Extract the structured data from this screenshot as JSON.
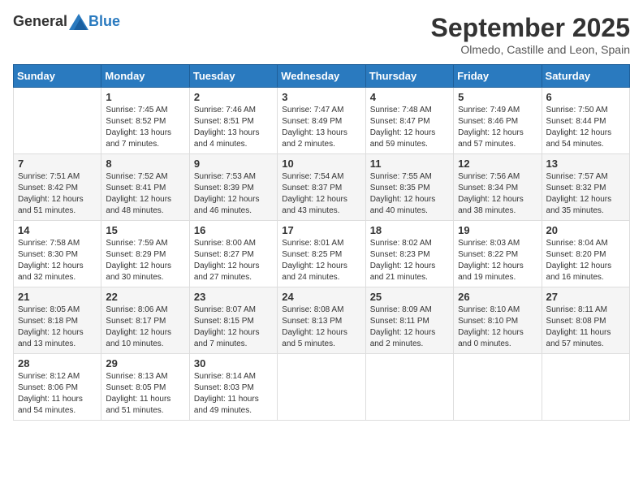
{
  "logo": {
    "general": "General",
    "blue": "Blue"
  },
  "title": "September 2025",
  "subtitle": "Olmedo, Castille and Leon, Spain",
  "days_of_week": [
    "Sunday",
    "Monday",
    "Tuesday",
    "Wednesday",
    "Thursday",
    "Friday",
    "Saturday"
  ],
  "weeks": [
    [
      {
        "day": "",
        "info": ""
      },
      {
        "day": "1",
        "info": "Sunrise: 7:45 AM\nSunset: 8:52 PM\nDaylight: 13 hours\nand 7 minutes."
      },
      {
        "day": "2",
        "info": "Sunrise: 7:46 AM\nSunset: 8:51 PM\nDaylight: 13 hours\nand 4 minutes."
      },
      {
        "day": "3",
        "info": "Sunrise: 7:47 AM\nSunset: 8:49 PM\nDaylight: 13 hours\nand 2 minutes."
      },
      {
        "day": "4",
        "info": "Sunrise: 7:48 AM\nSunset: 8:47 PM\nDaylight: 12 hours\nand 59 minutes."
      },
      {
        "day": "5",
        "info": "Sunrise: 7:49 AM\nSunset: 8:46 PM\nDaylight: 12 hours\nand 57 minutes."
      },
      {
        "day": "6",
        "info": "Sunrise: 7:50 AM\nSunset: 8:44 PM\nDaylight: 12 hours\nand 54 minutes."
      }
    ],
    [
      {
        "day": "7",
        "info": "Sunrise: 7:51 AM\nSunset: 8:42 PM\nDaylight: 12 hours\nand 51 minutes."
      },
      {
        "day": "8",
        "info": "Sunrise: 7:52 AM\nSunset: 8:41 PM\nDaylight: 12 hours\nand 48 minutes."
      },
      {
        "day": "9",
        "info": "Sunrise: 7:53 AM\nSunset: 8:39 PM\nDaylight: 12 hours\nand 46 minutes."
      },
      {
        "day": "10",
        "info": "Sunrise: 7:54 AM\nSunset: 8:37 PM\nDaylight: 12 hours\nand 43 minutes."
      },
      {
        "day": "11",
        "info": "Sunrise: 7:55 AM\nSunset: 8:35 PM\nDaylight: 12 hours\nand 40 minutes."
      },
      {
        "day": "12",
        "info": "Sunrise: 7:56 AM\nSunset: 8:34 PM\nDaylight: 12 hours\nand 38 minutes."
      },
      {
        "day": "13",
        "info": "Sunrise: 7:57 AM\nSunset: 8:32 PM\nDaylight: 12 hours\nand 35 minutes."
      }
    ],
    [
      {
        "day": "14",
        "info": "Sunrise: 7:58 AM\nSunset: 8:30 PM\nDaylight: 12 hours\nand 32 minutes."
      },
      {
        "day": "15",
        "info": "Sunrise: 7:59 AM\nSunset: 8:29 PM\nDaylight: 12 hours\nand 30 minutes."
      },
      {
        "day": "16",
        "info": "Sunrise: 8:00 AM\nSunset: 8:27 PM\nDaylight: 12 hours\nand 27 minutes."
      },
      {
        "day": "17",
        "info": "Sunrise: 8:01 AM\nSunset: 8:25 PM\nDaylight: 12 hours\nand 24 minutes."
      },
      {
        "day": "18",
        "info": "Sunrise: 8:02 AM\nSunset: 8:23 PM\nDaylight: 12 hours\nand 21 minutes."
      },
      {
        "day": "19",
        "info": "Sunrise: 8:03 AM\nSunset: 8:22 PM\nDaylight: 12 hours\nand 19 minutes."
      },
      {
        "day": "20",
        "info": "Sunrise: 8:04 AM\nSunset: 8:20 PM\nDaylight: 12 hours\nand 16 minutes."
      }
    ],
    [
      {
        "day": "21",
        "info": "Sunrise: 8:05 AM\nSunset: 8:18 PM\nDaylight: 12 hours\nand 13 minutes."
      },
      {
        "day": "22",
        "info": "Sunrise: 8:06 AM\nSunset: 8:17 PM\nDaylight: 12 hours\nand 10 minutes."
      },
      {
        "day": "23",
        "info": "Sunrise: 8:07 AM\nSunset: 8:15 PM\nDaylight: 12 hours\nand 7 minutes."
      },
      {
        "day": "24",
        "info": "Sunrise: 8:08 AM\nSunset: 8:13 PM\nDaylight: 12 hours\nand 5 minutes."
      },
      {
        "day": "25",
        "info": "Sunrise: 8:09 AM\nSunset: 8:11 PM\nDaylight: 12 hours\nand 2 minutes."
      },
      {
        "day": "26",
        "info": "Sunrise: 8:10 AM\nSunset: 8:10 PM\nDaylight: 12 hours\nand 0 minutes."
      },
      {
        "day": "27",
        "info": "Sunrise: 8:11 AM\nSunset: 8:08 PM\nDaylight: 11 hours\nand 57 minutes."
      }
    ],
    [
      {
        "day": "28",
        "info": "Sunrise: 8:12 AM\nSunset: 8:06 PM\nDaylight: 11 hours\nand 54 minutes."
      },
      {
        "day": "29",
        "info": "Sunrise: 8:13 AM\nSunset: 8:05 PM\nDaylight: 11 hours\nand 51 minutes."
      },
      {
        "day": "30",
        "info": "Sunrise: 8:14 AM\nSunset: 8:03 PM\nDaylight: 11 hours\nand 49 minutes."
      },
      {
        "day": "",
        "info": ""
      },
      {
        "day": "",
        "info": ""
      },
      {
        "day": "",
        "info": ""
      },
      {
        "day": "",
        "info": ""
      }
    ]
  ]
}
